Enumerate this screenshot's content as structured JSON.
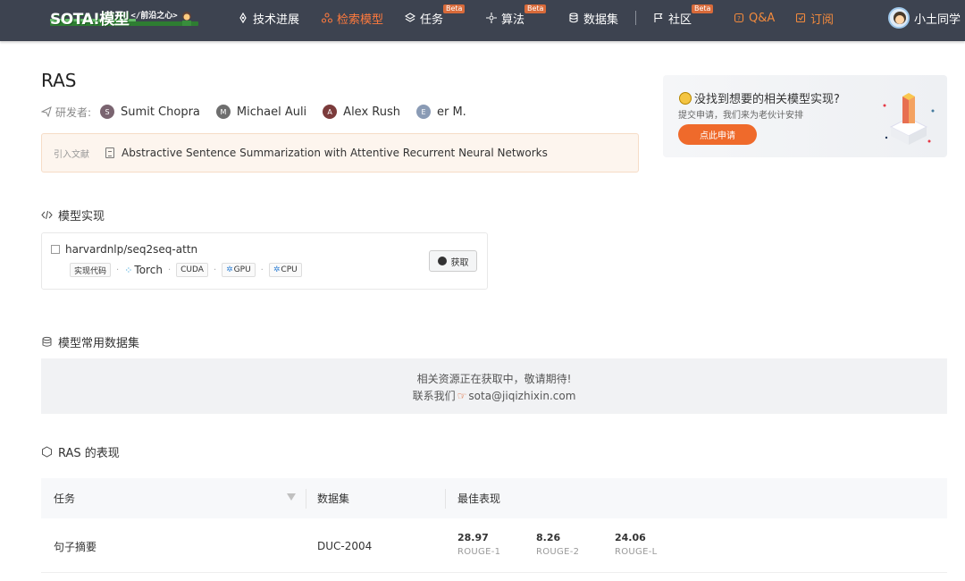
{
  "header": {
    "logo_text": "SOTA!模型",
    "logo_tag": "</前沿之心>",
    "nav": [
      {
        "label": "技术进展",
        "icon": "rocket-icon"
      },
      {
        "label": "检索模型",
        "icon": "network-icon",
        "active": true
      },
      {
        "label": "任务",
        "icon": "layers-icon",
        "badge": "Beta"
      },
      {
        "label": "算法",
        "icon": "algorithm-icon",
        "badge": "Beta"
      },
      {
        "label": "数据集",
        "icon": "database-icon"
      },
      {
        "label": "社区",
        "icon": "flag-icon",
        "badge": "Beta"
      },
      {
        "label": "Q&A",
        "icon": "qa-icon"
      },
      {
        "label": "订阅",
        "icon": "subscribe-icon"
      }
    ],
    "user_name": "小土同学"
  },
  "model": {
    "title": "RAS",
    "authors_label": "研发者:",
    "authors": [
      {
        "initial": "S",
        "name": "Sumit Chopra",
        "color": "#7a6470"
      },
      {
        "initial": "M",
        "name": "Michael Auli",
        "color": "#6e6e6e"
      },
      {
        "initial": "A",
        "name": "Alex Rush",
        "color": "#7b3b3b"
      },
      {
        "initial": "E",
        "name": "er M.",
        "color": "#8a9bb5"
      }
    ],
    "citation_label": "引入文献",
    "citation": "Abstractive Sentence Summarization with Attentive Recurrent Neural Networks"
  },
  "promo": {
    "question": "没找到想要的相关模型实现?",
    "subtitle": "提交申请，我们来为老伙计安排",
    "button": "点此申请"
  },
  "implementation": {
    "section_title": "模型实现",
    "repo": "harvardnlp/seq2seq-attn",
    "code_tag": "实现代码",
    "framework": "Torch",
    "tags": [
      "CUDA",
      "GPU",
      "CPU"
    ],
    "get_button": "获取"
  },
  "datasets": {
    "section_title": "模型常用数据集",
    "line1": "相关资源正在获取中，敬请期待!",
    "line2_prefix": "联系我们",
    "email": "sota@jiqizhixin.com"
  },
  "performance": {
    "section_title": "RAS 的表现",
    "columns": [
      "任务",
      "数据集",
      "最佳表现"
    ],
    "rows": [
      {
        "task": "句子摘要",
        "dataset": "DUC-2004",
        "metrics": [
          {
            "value": "28.97",
            "name": "ROUGE-1"
          },
          {
            "value": "8.26",
            "name": "ROUGE-2"
          },
          {
            "value": "24.06",
            "name": "ROUGE-L"
          }
        ]
      }
    ]
  },
  "colors": {
    "nav_bg": "#3d4350",
    "accent": "#ef6a2b",
    "citation_bg": "#fdf5ee"
  }
}
